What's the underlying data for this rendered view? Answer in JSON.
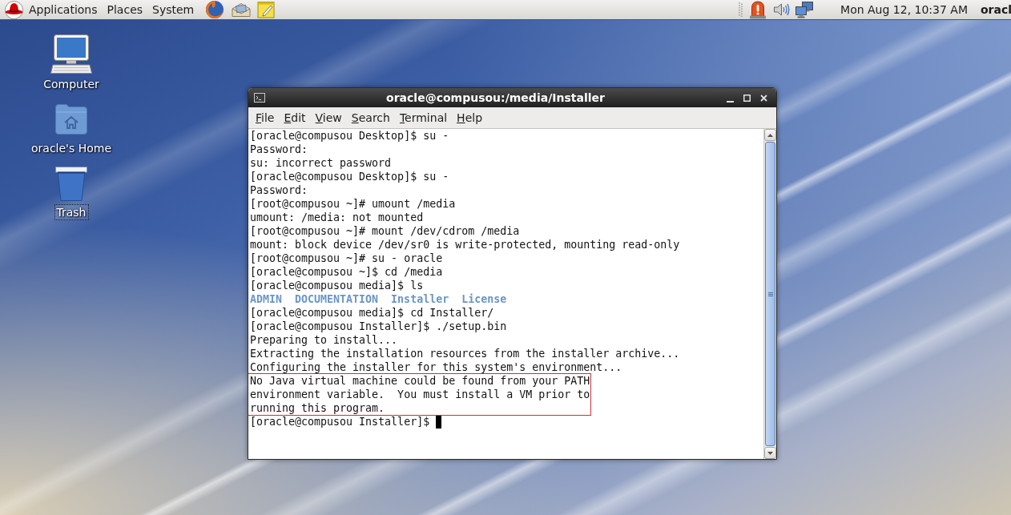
{
  "top_panel": {
    "menus": [
      "Applications",
      "Places",
      "System"
    ],
    "clock": "Mon Aug 12, 10:37 AM",
    "user": "oracl"
  },
  "desktop_icons": [
    {
      "kind": "computer",
      "label": "Computer",
      "selected": false
    },
    {
      "kind": "home",
      "label": "oracle's Home",
      "selected": false
    },
    {
      "kind": "trash",
      "label": "Trash",
      "selected": true
    }
  ],
  "terminal": {
    "title": "oracle@compusou:/media/Installer",
    "menu": [
      "File",
      "Edit",
      "View",
      "Search",
      "Terminal",
      "Help"
    ],
    "lines": [
      {
        "kind": "text",
        "text": "[oracle@compusou Desktop]$ su -"
      },
      {
        "kind": "text",
        "text": "Password:"
      },
      {
        "kind": "text",
        "text": "su: incorrect password"
      },
      {
        "kind": "text",
        "text": "[oracle@compusou Desktop]$ su -"
      },
      {
        "kind": "text",
        "text": "Password:"
      },
      {
        "kind": "text",
        "text": "[root@compusou ~]# umount /media"
      },
      {
        "kind": "text",
        "text": "umount: /media: not mounted"
      },
      {
        "kind": "text",
        "text": "[root@compusou ~]# mount /dev/cdrom /media"
      },
      {
        "kind": "text",
        "text": "mount: block device /dev/sr0 is write-protected, mounting read-only"
      },
      {
        "kind": "text",
        "text": "[root@compusou ~]# su - oracle"
      },
      {
        "kind": "text",
        "text": "[oracle@compusou ~]$ cd /media"
      },
      {
        "kind": "text",
        "text": "[oracle@compusou media]$ ls"
      },
      {
        "kind": "listing",
        "entries": [
          "ADMIN",
          "DOCUMENTATION",
          "Installer",
          "License"
        ]
      },
      {
        "kind": "text",
        "text": "[oracle@compusou media]$ cd Installer/"
      },
      {
        "kind": "text",
        "text": "[oracle@compusou Installer]$ ./setup.bin"
      },
      {
        "kind": "text",
        "text": "Preparing to install..."
      },
      {
        "kind": "text",
        "text": "Extracting the installation resources from the installer archive..."
      },
      {
        "kind": "text",
        "text": "Configuring the installer for this system's environment..."
      },
      {
        "kind": "annotated",
        "lines": [
          "No Java virtual machine could be found from your PATH",
          "environment variable.  You must install a VM prior to",
          "running this program."
        ]
      },
      {
        "kind": "prompt",
        "text": "[oracle@compusou Installer]$",
        "cursor": true
      }
    ]
  }
}
